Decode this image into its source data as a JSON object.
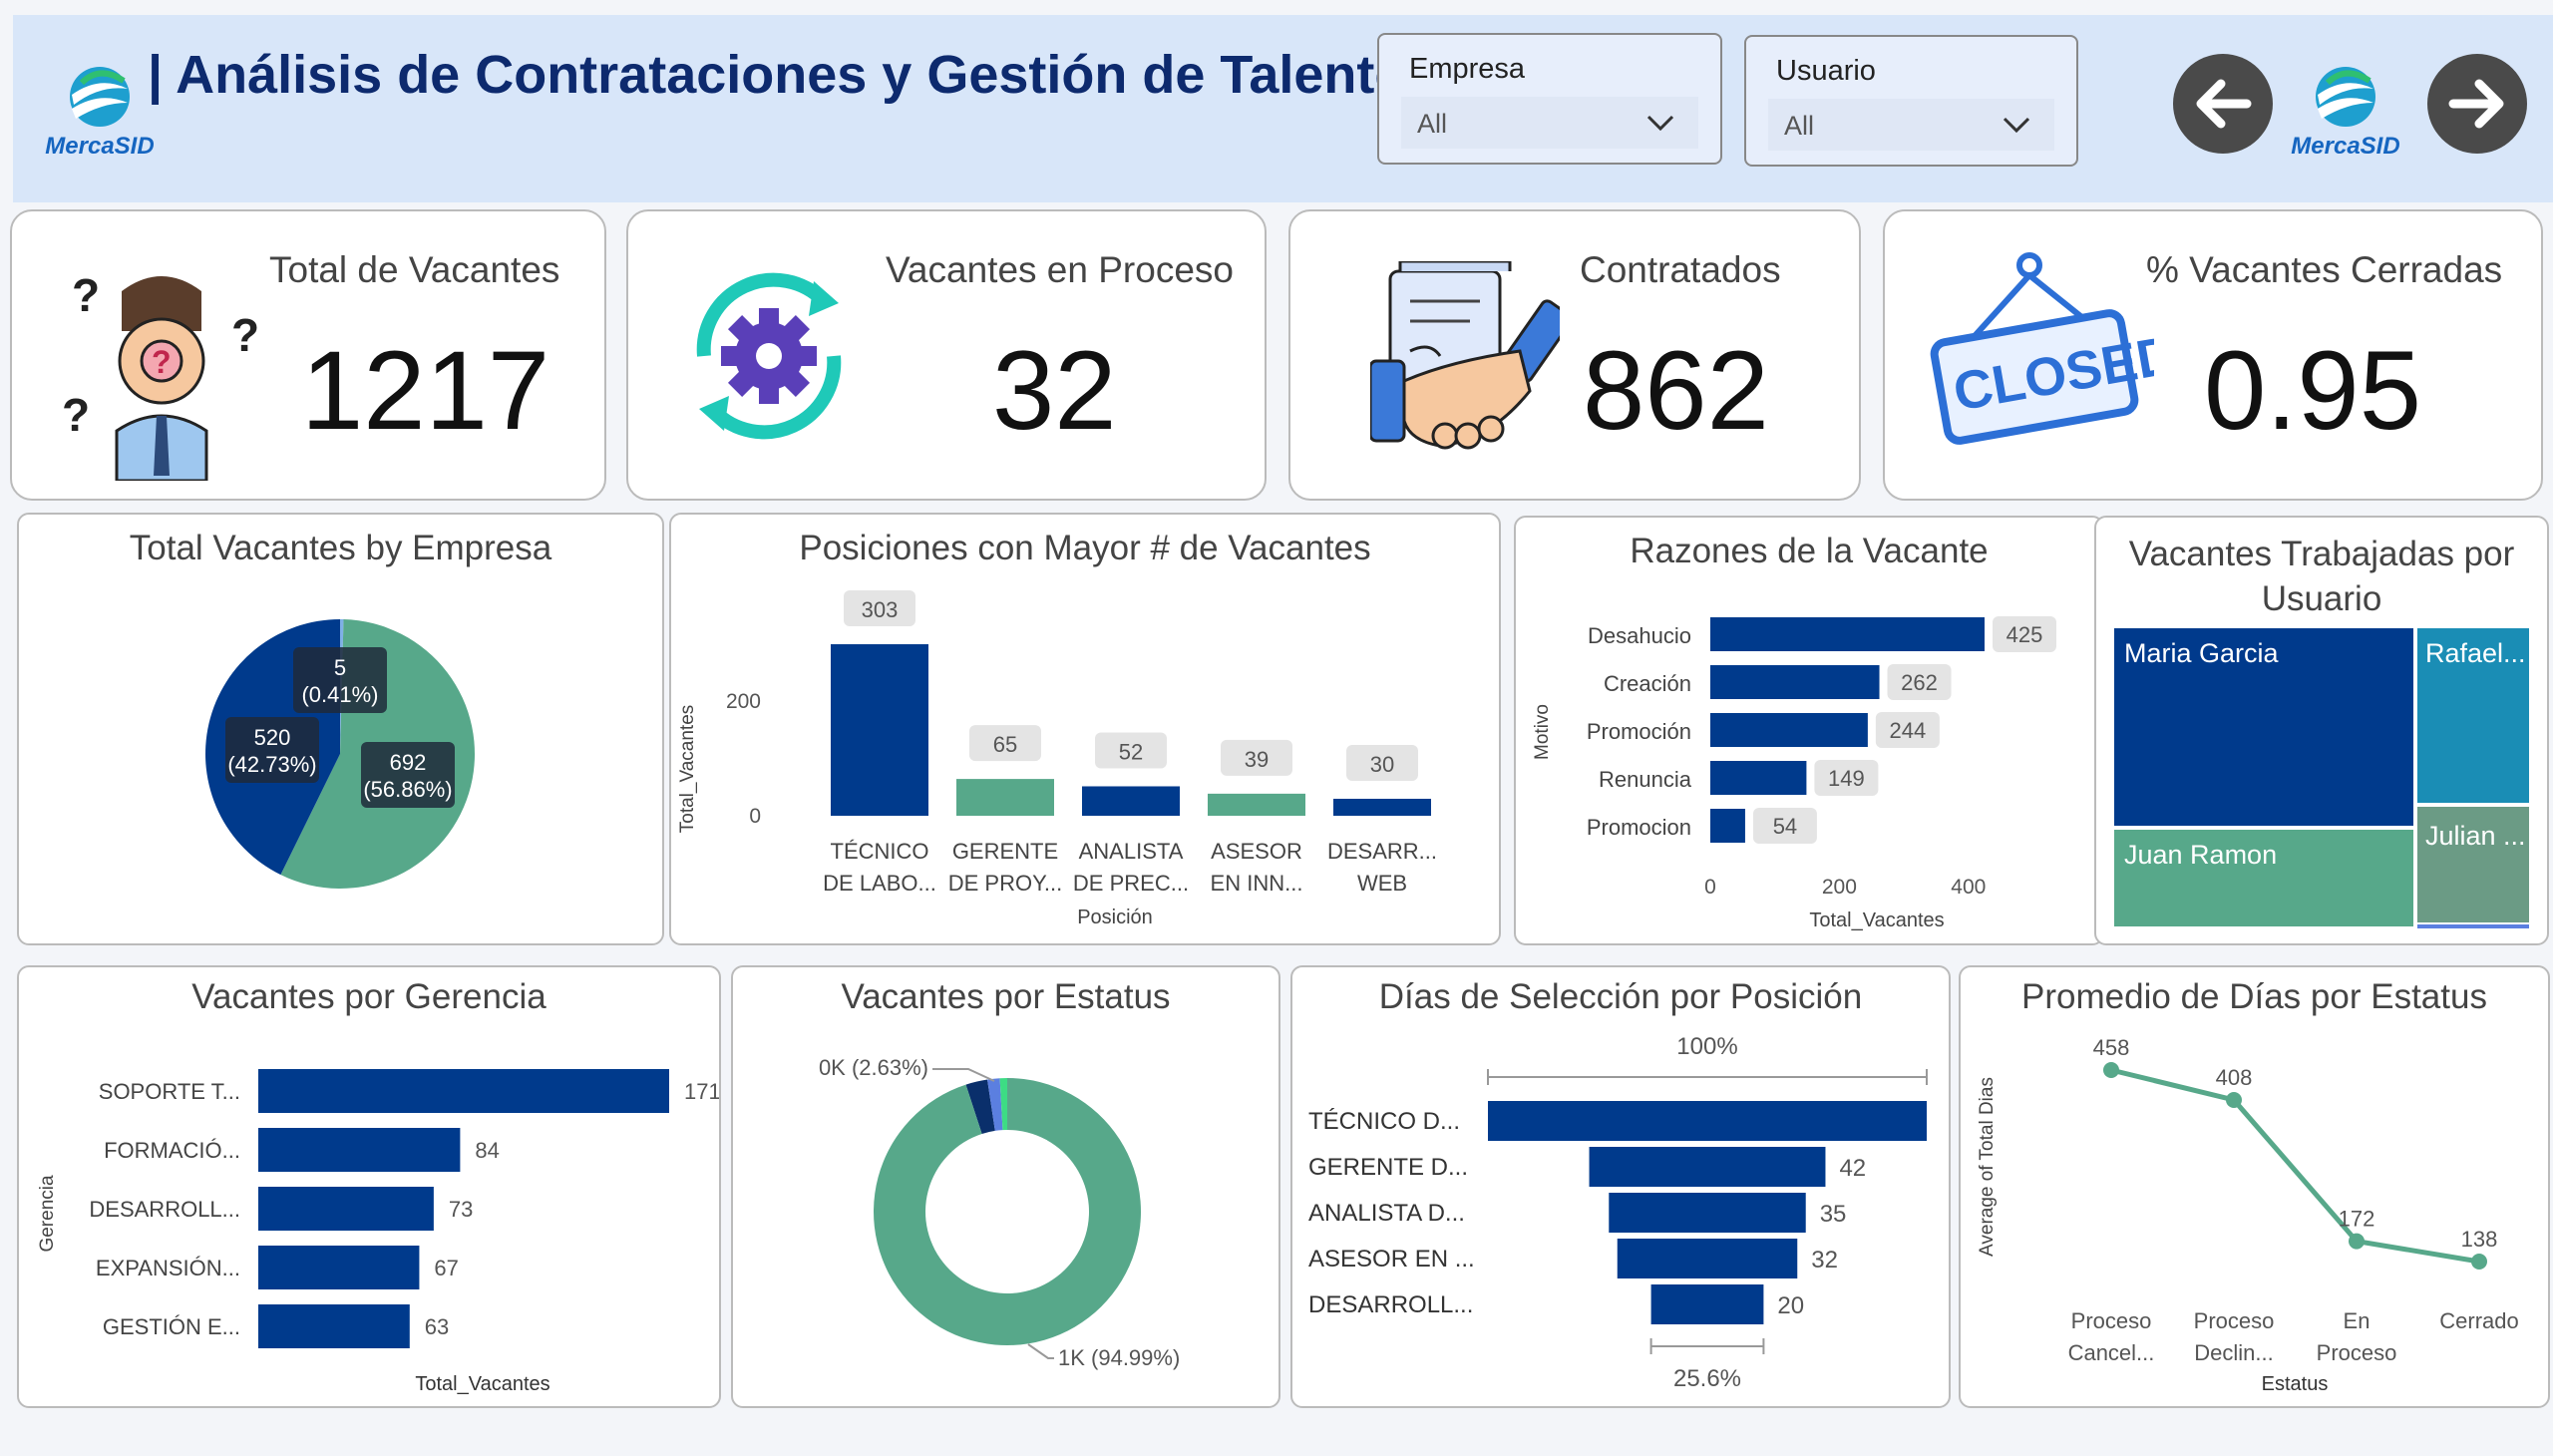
{
  "header": {
    "title": "| Análisis de Contrataciones y Gestión de Talento",
    "brand": "MercaSID"
  },
  "filters": [
    {
      "label": "Empresa",
      "value": "All"
    },
    {
      "label": "Usuario",
      "value": "All"
    }
  ],
  "kpis": [
    {
      "label": "Total de Vacantes",
      "value": "1217"
    },
    {
      "label": "Vacantes en Proceso",
      "value": "32"
    },
    {
      "label": "Contratados",
      "value": "862"
    },
    {
      "label": "% Vacantes Cerradas",
      "value": "0.95"
    }
  ],
  "colors": {
    "navy": "#003a8c",
    "teal": "#57a88a",
    "title": "#0d2a6e",
    "accent_purple": "#5a3fb8",
    "accent_cyan": "#1fc9b8"
  },
  "panels": {
    "empresa": {
      "title": "Total Vacantes by Empresa"
    },
    "posiciones": {
      "title": "Posiciones con Mayor # de Vacantes"
    },
    "razones": {
      "title": "Razones de la Vacante"
    },
    "usuario": {
      "title_line1": "Vacantes Trabajadas por",
      "title_line2": "Usuario"
    },
    "gerencia": {
      "title": "Vacantes por Gerencia"
    },
    "estatus": {
      "title": "Vacantes por Estatus"
    },
    "dias": {
      "title": "Días de Selección por Posición"
    },
    "promedio": {
      "title": "Promedio de Días por Estatus"
    }
  },
  "chart_data": [
    {
      "id": "empresa",
      "type": "pie",
      "title": "Total Vacantes by Empresa",
      "slices": [
        {
          "value": 692,
          "label_value": "692",
          "label_pct": "(56.86%)",
          "color": "#57a88a"
        },
        {
          "value": 520,
          "label_value": "520",
          "label_pct": "(42.73%)",
          "color": "#003a8c"
        },
        {
          "value": 5,
          "label_value": "5",
          "label_pct": "(0.41%)",
          "color": "#7fb0e6"
        }
      ]
    },
    {
      "id": "posiciones",
      "type": "bar",
      "title": "Posiciones con Mayor # de Vacantes",
      "xlabel": "Posición",
      "ylabel": "Total_Vacantes",
      "ylim": [
        0,
        303
      ],
      "yticks": [
        "200",
        "0"
      ],
      "categories": [
        [
          "TÉCNICO",
          "DE LABO..."
        ],
        [
          "GERENTE",
          "DE PROY..."
        ],
        [
          "ANALISTA",
          "DE PREC..."
        ],
        [
          "ASESOR",
          "EN INN..."
        ],
        [
          "DESARR...",
          "WEB"
        ]
      ],
      "values": [
        303,
        65,
        52,
        39,
        30
      ],
      "colors": [
        "#003a8c",
        "#57a88a",
        "#003a8c",
        "#57a88a",
        "#003a8c"
      ]
    },
    {
      "id": "razones",
      "type": "bar",
      "orientation": "horizontal",
      "title": "Razones de la Vacante",
      "xlabel": "Total_Vacantes",
      "ylabel": "Motivo",
      "xlim": [
        0,
        425
      ],
      "xticks": [
        "0",
        "200",
        "400"
      ],
      "categories": [
        "Desahucio",
        "Creación",
        "Promoción",
        "Renuncia",
        "Promocion"
      ],
      "values": [
        425,
        262,
        244,
        149,
        54
      ]
    },
    {
      "id": "usuario",
      "type": "treemap",
      "title": "Vacantes Trabajadas por Usuario",
      "items": [
        {
          "name": "Maria Garcia",
          "color": "#003a8c"
        },
        {
          "name": "Rafael...",
          "color": "#1a8db5"
        },
        {
          "name": "Juan Ramon",
          "color": "#57a88a"
        },
        {
          "name": "Julian ...",
          "color": "#6b9b85"
        }
      ]
    },
    {
      "id": "gerencia",
      "type": "bar",
      "orientation": "horizontal",
      "title": "Vacantes por Gerencia",
      "xlabel": "Total_Vacantes",
      "ylabel": "Gerencia",
      "xlim": [
        0,
        171
      ],
      "categories": [
        "SOPORTE T...",
        "FORMACIÓ...",
        "DESARROLL...",
        "EXPANSIÓN...",
        "GESTIÓN E..."
      ],
      "values": [
        171,
        84,
        73,
        67,
        63
      ]
    },
    {
      "id": "estatus",
      "type": "pie",
      "title": "Vacantes por Estatus",
      "slices": [
        {
          "value": 94.99,
          "label": "1K (94.99%)",
          "color": "#57a88a"
        },
        {
          "value": 2.63,
          "label": "0K (2.63%)",
          "color": "#0a2f6b"
        },
        {
          "value": 1.5,
          "label": "",
          "color": "#5b7fe0"
        },
        {
          "value": 0.88,
          "label": "",
          "color": "#3ddc84"
        }
      ]
    },
    {
      "id": "dias",
      "type": "bar",
      "orientation": "funnel",
      "title": "Días de Selección por Posición",
      "top_pct": "100%",
      "bottom_pct": "25.6%",
      "categories": [
        "TÉCNICO D...",
        "GERENTE D...",
        "ANALISTA D...",
        "ASESOR EN ...",
        "DESARROLL..."
      ],
      "values": [
        78,
        42,
        35,
        32,
        20
      ],
      "value_labels": [
        "",
        "42",
        "35",
        "32",
        "20"
      ]
    },
    {
      "id": "promedio",
      "type": "line",
      "title": "Promedio de Días por Estatus",
      "xlabel": "Estatus",
      "ylabel": "Average of Total Dias",
      "categories": [
        [
          "Proceso",
          "Cancel..."
        ],
        [
          "Proceso",
          "Declin..."
        ],
        [
          "En",
          "Proceso"
        ],
        [
          "Cerrado",
          ""
        ]
      ],
      "values": [
        458,
        408,
        172,
        138
      ],
      "ylim": [
        0,
        458
      ]
    }
  ]
}
